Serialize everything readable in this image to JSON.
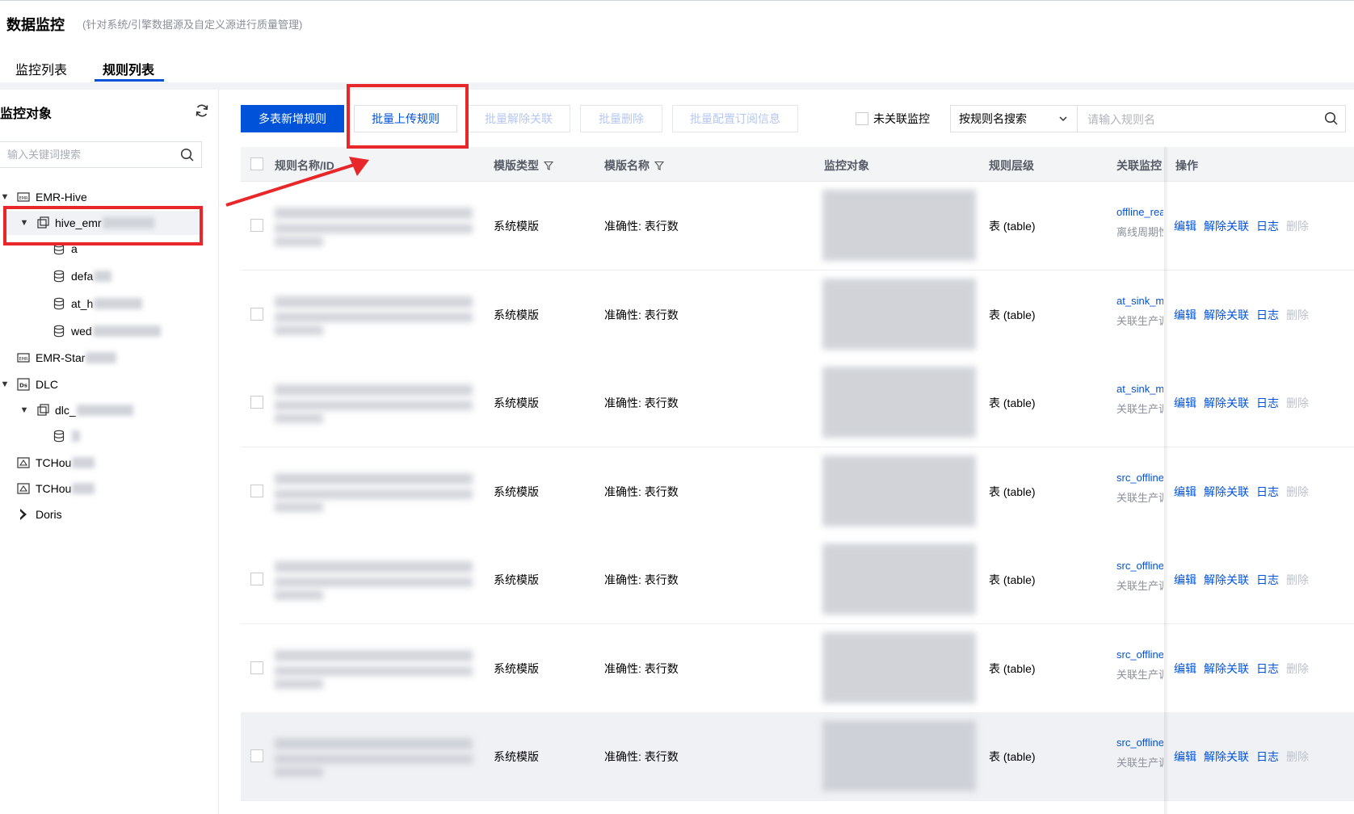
{
  "header": {
    "title": "数据监控",
    "subtitle": "(针对系统/引擎数据源及自定义源进行质量管理)"
  },
  "tabs": [
    {
      "label": "监控列表",
      "active": false
    },
    {
      "label": "规则列表",
      "active": true
    }
  ],
  "left_panel": {
    "title": "监控对象",
    "search_placeholder": "输入关键词搜索",
    "tree": [
      {
        "label": "EMR-Hive",
        "icon": "emr-icon"
      },
      {
        "label": "hive_emr",
        "icon": "cluster-icon",
        "selected": true
      },
      {
        "label": "a",
        "icon": "database-icon"
      },
      {
        "label": "defa",
        "icon": "database-icon"
      },
      {
        "label": "at_h",
        "icon": "database-icon"
      },
      {
        "label": "wed",
        "icon": "database-icon"
      },
      {
        "label": "EMR-Star",
        "icon": "emr-icon"
      },
      {
        "label": "DLC",
        "icon": "dlc-icon"
      },
      {
        "label": "dlc_",
        "icon": "cluster-icon"
      },
      {
        "label": "",
        "icon": "database-icon"
      },
      {
        "label": "TCHou",
        "icon": "tchouse-icon"
      },
      {
        "label": "TCHou",
        "icon": "tchouse-icon"
      },
      {
        "label": "Doris",
        "icon": "doris-icon"
      }
    ]
  },
  "toolbar": {
    "add_multi": "多表新增规则",
    "batch_upload": "批量上传规则",
    "batch_unlink": "批量解除关联",
    "batch_delete": "批量删除",
    "batch_subscribe": "批量配置订阅信息",
    "unlinked_label": "未关联监控",
    "search_type": "按规则名搜索",
    "search_placeholder": "请输入规则名"
  },
  "table": {
    "columns": [
      "规则名称/ID",
      "模版类型",
      "模版名称",
      "监控对象",
      "规则层级",
      "关联监控",
      "操作"
    ],
    "rows": [
      {
        "template_type": "系统模版",
        "template_name": "准确性: 表行数",
        "level": "表 (table)",
        "monitor": "offline_rea",
        "monitor_sub": "离线周期性"
      },
      {
        "template_type": "系统模版",
        "template_name": "准确性: 表行数",
        "level": "表 (table)",
        "monitor": "at_sink_m",
        "monitor_sub": "关联生产调"
      },
      {
        "template_type": "系统模版",
        "template_name": "准确性: 表行数",
        "level": "表 (table)",
        "monitor": "at_sink_m",
        "monitor_sub": "关联生产调"
      },
      {
        "template_type": "系统模版",
        "template_name": "准确性: 表行数",
        "level": "表 (table)",
        "monitor": "src_offline",
        "monitor_sub": "关联生产调"
      },
      {
        "template_type": "系统模版",
        "template_name": "准确性: 表行数",
        "level": "表 (table)",
        "monitor": "src_offline",
        "monitor_sub": "关联生产调"
      },
      {
        "template_type": "系统模版",
        "template_name": "准确性: 表行数",
        "level": "表 (table)",
        "monitor": "src_offline",
        "monitor_sub": "关联生产调"
      },
      {
        "template_type": "系统模版",
        "template_name": "准确性: 表行数",
        "level": "表 (table)",
        "monitor": "src_offline",
        "monitor_sub": "关联生产调"
      }
    ],
    "ops": {
      "edit": "编辑",
      "unlink": "解除关联",
      "log": "日志",
      "delete": "删除"
    }
  },
  "colors": {
    "primary": "#0052d9",
    "annotation": "#e8272a",
    "disabled_text": "#b5c7f0"
  }
}
